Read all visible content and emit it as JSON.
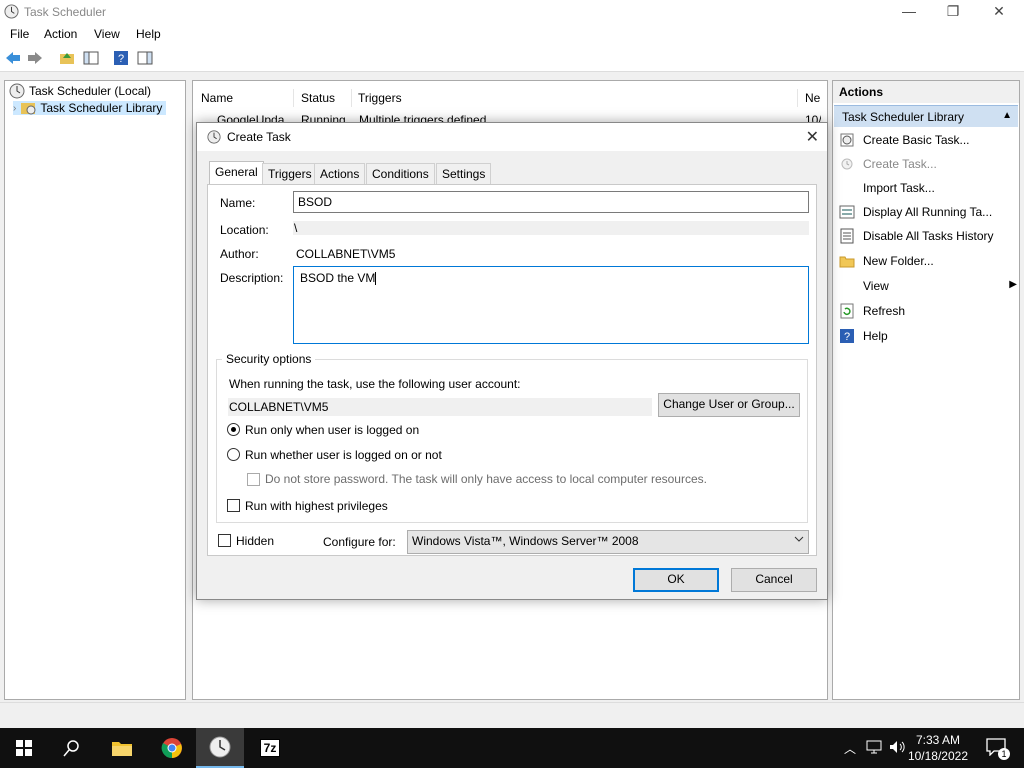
{
  "window": {
    "title": "Task Scheduler",
    "minimize": "—",
    "maximize": "❐",
    "close": "✕"
  },
  "menu": [
    "File",
    "Action",
    "View",
    "Help"
  ],
  "tree": {
    "root": "Task Scheduler (Local)",
    "library": "Task Scheduler Library"
  },
  "table": {
    "columns": [
      "Name",
      "Status",
      "Triggers",
      "Ne"
    ],
    "row": {
      "name": "GoogleUpda",
      "status": "Running",
      "triggers": "Multiple triggers defined",
      "next": "10/"
    }
  },
  "actions": {
    "header": "Actions",
    "section": "Task Scheduler Library",
    "items": [
      {
        "label": "Create Basic Task...",
        "icon": "create-basic-task-icon",
        "enabled": true
      },
      {
        "label": "Create Task...",
        "icon": "create-task-icon",
        "enabled": false
      },
      {
        "label": "Import Task...",
        "icon": "",
        "enabled": true
      },
      {
        "label": "Display All Running Ta...",
        "icon": "running-tasks-icon",
        "enabled": true
      },
      {
        "label": "Disable All Tasks History",
        "icon": "history-icon",
        "enabled": true
      },
      {
        "label": "New Folder...",
        "icon": "folder-icon",
        "enabled": true
      },
      {
        "label": "View",
        "icon": "",
        "enabled": true
      },
      {
        "label": "Refresh",
        "icon": "refresh-icon",
        "enabled": true
      },
      {
        "label": "Help",
        "icon": "help-icon",
        "enabled": true
      }
    ]
  },
  "dialog": {
    "title": "Create Task",
    "tabs": [
      "General",
      "Triggers",
      "Actions",
      "Conditions",
      "Settings"
    ],
    "active_tab": "General",
    "name_label": "Name:",
    "name_value": "BSOD",
    "location_label": "Location:",
    "location_value": "\\",
    "author_label": "Author:",
    "author_value": "COLLABNET\\VM5",
    "description_label": "Description:",
    "description_value": "BSOD the VM",
    "security": {
      "legend": "Security options",
      "account_prompt": "When running the task, use the following user account:",
      "account_value": "COLLABNET\\VM5",
      "change_button": "Change User or Group...",
      "run_logged_on": "Run only when user is logged on",
      "run_whether": "Run whether user is logged on or not",
      "no_store_password": "Do not store password.  The task will only have access to local computer resources.",
      "highest_privileges": "Run with highest privileges"
    },
    "hidden_label": "Hidden",
    "configure_label": "Configure for:",
    "configure_value": "Windows Vista™, Windows Server™ 2008",
    "ok": "OK",
    "cancel": "Cancel"
  },
  "taskbar": {
    "time": "7:33 AM",
    "date": "10/18/2022",
    "notification_count": "1",
    "seven_zip": "7z"
  },
  "colors": {
    "accent": "#0078d7",
    "selection": "#cfe0f2",
    "taskbar": "#101010"
  }
}
